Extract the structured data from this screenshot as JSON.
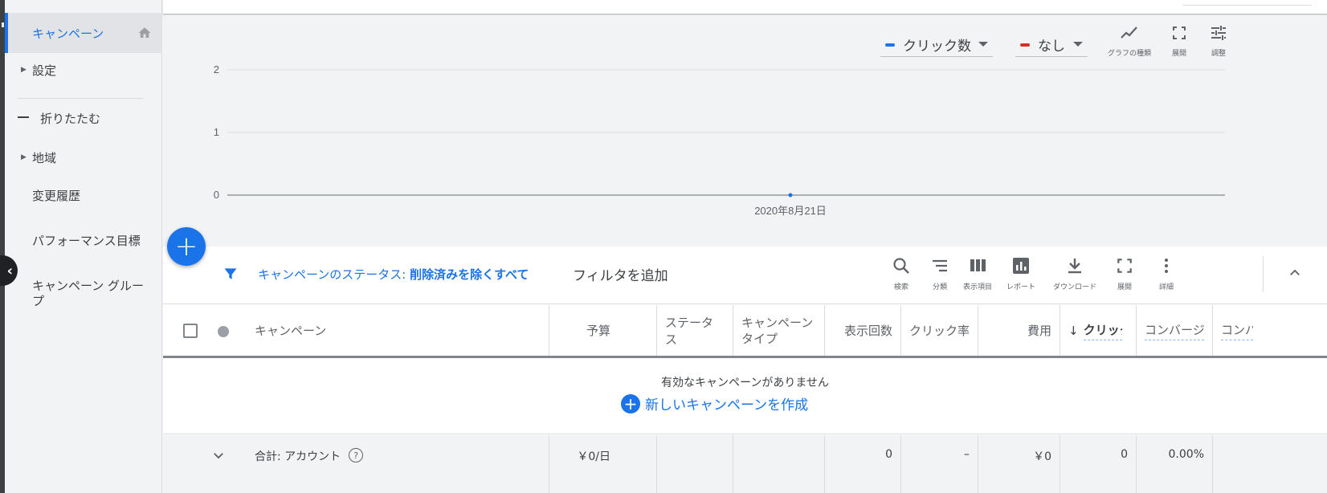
{
  "sidebar": {
    "items": [
      {
        "label": "キャンペーン",
        "active": true
      },
      {
        "label": "設定"
      },
      {
        "label": "折りたたむ"
      },
      {
        "label": "地域"
      },
      {
        "label": "変更履歴"
      },
      {
        "label": "パフォーマンス目標"
      },
      {
        "label": "キャンペーン グループ"
      }
    ]
  },
  "chart": {
    "metric1": "クリック数",
    "metric1_color": "#1a73e8",
    "metric2": "なし",
    "metric2_color": "#d93025",
    "tools": {
      "chart_type": "グラフの種類",
      "expand": "展開",
      "adjust": "調整"
    }
  },
  "chart_data": {
    "type": "line",
    "x": [
      "2020年8月21日"
    ],
    "series": [
      {
        "values": [
          0
        ]
      }
    ],
    "ylim": [
      0,
      2
    ],
    "yticks": [
      "0",
      "1",
      "2"
    ],
    "grid": true
  },
  "filter": {
    "prefix": "キャンペーンのステータス: ",
    "value": "削除済みを除くすべて",
    "add": "フィルタを追加"
  },
  "toolbar": {
    "search": "検索",
    "segment": "分類",
    "columns": "表示項目",
    "reports": "レポート",
    "download": "ダウンロード",
    "expand": "展開",
    "more": "詳細"
  },
  "table": {
    "headers": {
      "campaign": "キャンペーン",
      "budget": "予算",
      "status": "ステータス",
      "type": "キャンペーン タイプ",
      "impr": "表示回数",
      "ctr": "クリック率",
      "cost": "費用",
      "clicks": "クリック数",
      "conv": "コンバージョン",
      "conv2": "コンバージョン"
    },
    "empty_message": "有効なキャンペーンがありません",
    "new_campaign": "新しいキャンペーンを作成",
    "total": {
      "label": "合計: アカウント",
      "budget": "￥0/日",
      "impr": "0",
      "ctr": "–",
      "cost": "￥0",
      "clicks": "0",
      "conv_rate": "0.00%"
    }
  }
}
